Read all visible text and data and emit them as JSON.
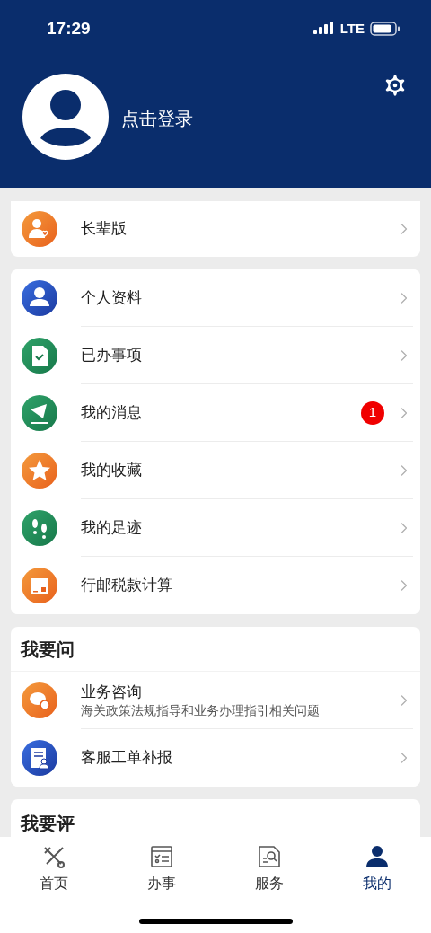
{
  "status_bar": {
    "time": "17:29",
    "network": "LTE"
  },
  "profile": {
    "login_text": "点击登录"
  },
  "senior_card": {
    "items": [
      {
        "label": "长辈版",
        "kind": "senior"
      }
    ]
  },
  "menu": {
    "items": [
      {
        "label": "个人资料",
        "kind": "profile"
      },
      {
        "label": "已办事项",
        "kind": "done"
      },
      {
        "label": "我的消息",
        "kind": "message",
        "badge": "1"
      },
      {
        "label": "我的收藏",
        "kind": "favorite"
      },
      {
        "label": "我的足迹",
        "kind": "footprint"
      },
      {
        "label": "行邮税款计算",
        "kind": "parcel"
      }
    ]
  },
  "ask_section": {
    "title": "我要问",
    "items": [
      {
        "label": "业务咨询",
        "subtitle": "海关政策法规指导和业务办理指引相关问题",
        "kind": "chat"
      },
      {
        "label": "客服工单补报",
        "kind": "ticket"
      }
    ]
  },
  "rate_section": {
    "title": "我要评"
  },
  "tab_bar": [
    {
      "label": "首页",
      "kind": "home",
      "selected": false
    },
    {
      "label": "办事",
      "kind": "tasks",
      "selected": false
    },
    {
      "label": "服务",
      "kind": "service",
      "selected": false
    },
    {
      "label": "我的",
      "kind": "me",
      "selected": true
    }
  ]
}
